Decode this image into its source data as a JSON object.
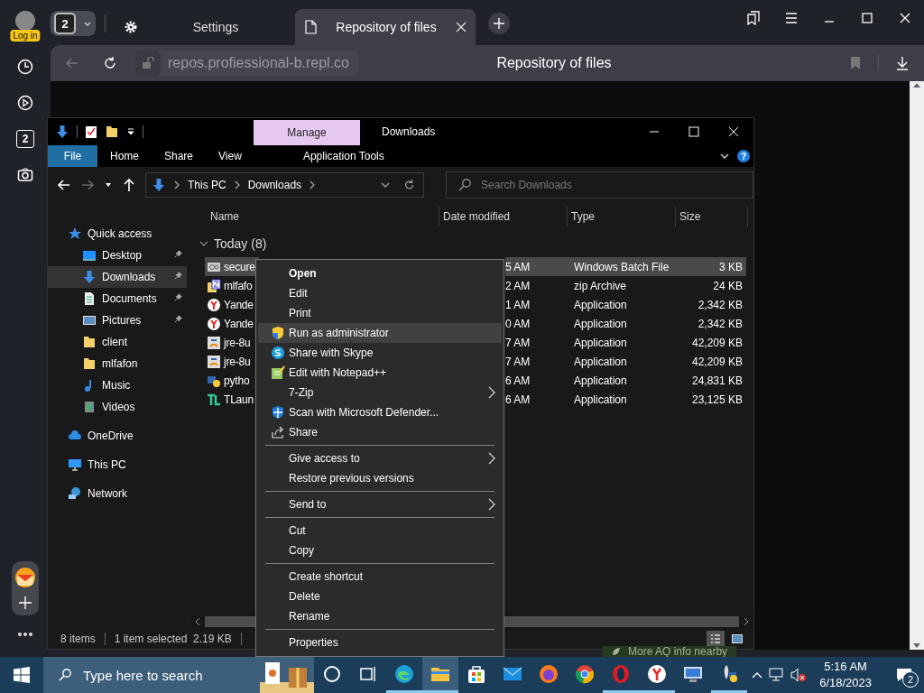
{
  "browser": {
    "profile_badge": "Log in",
    "panel_badge": "2",
    "tab_count": "2",
    "tabs": [
      {
        "label": "Settings",
        "selected": false
      },
      {
        "label": "Repository of files",
        "selected": true
      }
    ],
    "url": "repos.profiessional-b.repl.co",
    "page_title": "Repository of files"
  },
  "explorer": {
    "title": "Downloads",
    "context_tab": "Manage",
    "ribbon_tabs": [
      {
        "label": "File",
        "kind": "file"
      },
      {
        "label": "Home",
        "kind": "tab"
      },
      {
        "label": "Share",
        "kind": "tab"
      },
      {
        "label": "View",
        "kind": "tab"
      },
      {
        "label": "Application Tools",
        "kind": "context"
      }
    ],
    "help_label": "?",
    "forward_disabled": true,
    "path": [
      "This PC",
      "Downloads"
    ],
    "search_placeholder": "Search Downloads",
    "columns": [
      "Name",
      "Date modified",
      "Type",
      "Size"
    ],
    "nav": [
      {
        "label": "Quick access",
        "children": [
          {
            "label": "Desktop",
            "pinned": true,
            "selected": false
          },
          {
            "label": "Downloads",
            "pinned": true,
            "selected": true
          },
          {
            "label": "Documents",
            "pinned": true,
            "selected": false
          },
          {
            "label": "Pictures",
            "pinned": true,
            "selected": false
          },
          {
            "label": "client",
            "pinned": false,
            "selected": false
          },
          {
            "label": "mlfafon",
            "pinned": false,
            "selected": false
          },
          {
            "label": "Music",
            "pinned": false,
            "selected": false
          },
          {
            "label": "Videos",
            "pinned": false,
            "selected": false
          }
        ]
      },
      {
        "label": "OneDrive"
      },
      {
        "label": "This PC"
      },
      {
        "label": "Network"
      }
    ],
    "group": "Today (8)",
    "files": [
      {
        "name": "secure",
        "date": "5 AM",
        "type": "Windows Batch File",
        "size": "3 KB",
        "selected": true
      },
      {
        "name": "mlfafo",
        "date": "2 AM",
        "type": "zip Archive",
        "size": "24 KB",
        "selected": false
      },
      {
        "name": "Yande",
        "date": "1 AM",
        "type": "Application",
        "size": "2,342 KB",
        "selected": false
      },
      {
        "name": "Yande",
        "date": "0 AM",
        "type": "Application",
        "size": "2,342 KB",
        "selected": false
      },
      {
        "name": "jre-8u",
        "date": "7 AM",
        "type": "Application",
        "size": "42,209 KB",
        "selected": false
      },
      {
        "name": "jre-8u",
        "date": "7 AM",
        "type": "Application",
        "size": "42,209 KB",
        "selected": false
      },
      {
        "name": "pytho",
        "date": "6 AM",
        "type": "Application",
        "size": "24,831 KB",
        "selected": false
      },
      {
        "name": "TLaun",
        "date": "6 AM",
        "type": "Application",
        "size": "23,125 KB",
        "selected": false
      }
    ],
    "status": {
      "count": "8 items",
      "selection": "1 item selected  2.19 KB"
    },
    "views": [
      {
        "selected": true
      },
      {
        "selected": false
      }
    ]
  },
  "context_menu": [
    {
      "kind": "item",
      "label": "Open",
      "default": true,
      "highlighted": false,
      "submenu": false
    },
    {
      "kind": "item",
      "label": "Edit",
      "default": false,
      "highlighted": false,
      "submenu": false
    },
    {
      "kind": "item",
      "label": "Print",
      "default": false,
      "highlighted": false,
      "submenu": false
    },
    {
      "kind": "item",
      "label": "Run as administrator",
      "default": false,
      "highlighted": true,
      "submenu": false
    },
    {
      "kind": "item",
      "label": "Share with Skype",
      "default": false,
      "highlighted": false,
      "submenu": false
    },
    {
      "kind": "item",
      "label": "Edit with Notepad++",
      "default": false,
      "highlighted": false,
      "submenu": false
    },
    {
      "kind": "item",
      "label": "7-Zip",
      "default": false,
      "highlighted": false,
      "submenu": true
    },
    {
      "kind": "item",
      "label": "Scan with Microsoft Defender...",
      "default": false,
      "highlighted": false,
      "submenu": false
    },
    {
      "kind": "item",
      "label": "Share",
      "default": false,
      "highlighted": false,
      "submenu": false
    },
    {
      "kind": "separator"
    },
    {
      "kind": "item",
      "label": "Give access to",
      "default": false,
      "highlighted": false,
      "submenu": true
    },
    {
      "kind": "item",
      "label": "Restore previous versions",
      "default": false,
      "highlighted": false,
      "submenu": false
    },
    {
      "kind": "separator"
    },
    {
      "kind": "item",
      "label": "Send to",
      "default": false,
      "highlighted": false,
      "submenu": true
    },
    {
      "kind": "separator"
    },
    {
      "kind": "item",
      "label": "Cut",
      "default": false,
      "highlighted": false,
      "submenu": false
    },
    {
      "kind": "item",
      "label": "Copy",
      "default": false,
      "highlighted": false,
      "submenu": false
    },
    {
      "kind": "separator"
    },
    {
      "kind": "item",
      "label": "Create shortcut",
      "default": false,
      "highlighted": false,
      "submenu": false
    },
    {
      "kind": "item",
      "label": "Delete",
      "default": false,
      "highlighted": false,
      "submenu": false
    },
    {
      "kind": "item",
      "label": "Rename",
      "default": false,
      "highlighted": false,
      "submenu": false
    },
    {
      "kind": "separator"
    },
    {
      "kind": "item",
      "label": "Properties",
      "default": false,
      "highlighted": false,
      "submenu": false
    }
  ],
  "widget_text": "More AQ info nearby",
  "taskbar": {
    "search_placeholder": "Type here to search",
    "apps": [
      {
        "running": false,
        "active": false
      },
      {
        "running": false,
        "active": false
      },
      {
        "running": true,
        "active": false
      },
      {
        "running": true,
        "active": true
      },
      {
        "running": false,
        "active": false
      },
      {
        "running": false,
        "active": false
      },
      {
        "running": false,
        "active": false
      },
      {
        "running": false,
        "active": false
      },
      {
        "running": true,
        "active": false
      },
      {
        "running": true,
        "active": false
      },
      {
        "running": false,
        "active": false
      },
      {
        "running": true,
        "active": false
      }
    ],
    "time": "5:16 AM",
    "date": "6/18/2023",
    "notifications": "2"
  }
}
